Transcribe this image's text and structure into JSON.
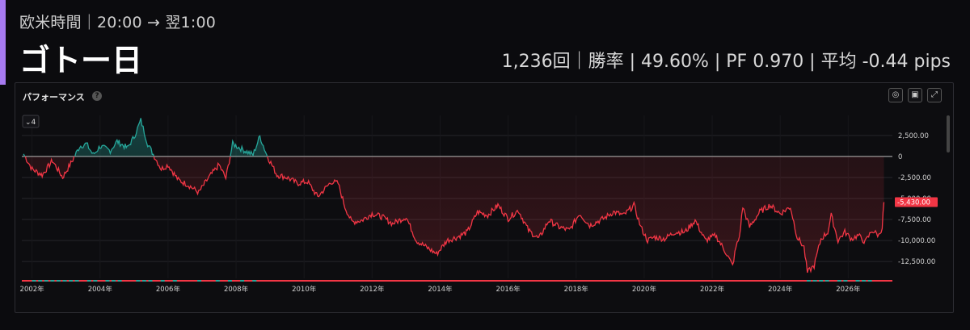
{
  "header": {
    "subtitle": "欧米時間｜20:00 → 翌1:00",
    "title": "ゴトー日",
    "stats": "1,236回｜勝率 | 49.60% | PF 0.970 | 平均 -0.44 pips"
  },
  "panel": {
    "title": "パフォーマンス",
    "help_icon": "question-icon",
    "dropdown_label": "4",
    "toolbar": [
      "settings-icon",
      "camera-icon",
      "expand-icon"
    ]
  },
  "chart_data": {
    "type": "area",
    "title": "パフォーマンス",
    "xlabel": "",
    "ylabel": "",
    "x_ticks": [
      "2002年",
      "2004年",
      "2006年",
      "2008年",
      "2010年",
      "2012年",
      "2014年",
      "2016年",
      "2018年",
      "2020年",
      "2022年",
      "2024年",
      "2026年"
    ],
    "y_ticks": [
      "2,500.00",
      "0",
      "-2,500.00",
      "-5,000.00",
      "-7,500.00",
      "-10,000.00",
      "-12,500.00"
    ],
    "ylim": [
      -14500,
      4500
    ],
    "xlim": [
      2001.7,
      2027.3
    ],
    "baseline": 0,
    "last_value_label": "-5,430.00",
    "colors": {
      "positive": "#26a69a",
      "negative": "#f23645",
      "baseline": "#bdbdbd",
      "grid": "#26262b",
      "label_bg": "#f23645"
    },
    "grid": true,
    "series": [
      {
        "x": [
          2001.75,
          2002.0,
          2002.3,
          2002.6,
          2002.9,
          2003.2,
          2003.4,
          2003.6,
          2003.8,
          2004.0,
          2004.3,
          2004.5,
          2004.8,
          2005.0,
          2005.2,
          2005.4,
          2005.6,
          2005.8,
          2006.0,
          2006.3,
          2006.6,
          2006.9,
          2007.2,
          2007.5,
          2007.7,
          2007.9,
          2008.2,
          2008.5,
          2008.7,
          2008.9,
          2009.2,
          2009.5,
          2009.8,
          2010.1,
          2010.4,
          2010.8,
          2011.0,
          2011.2,
          2011.4,
          2011.7,
          2012.0,
          2012.3,
          2012.6,
          2013.0,
          2013.3,
          2013.6,
          2013.9,
          2014.2,
          2014.5,
          2014.8,
          2015.1,
          2015.4,
          2015.7,
          2016.0,
          2016.3,
          2016.6,
          2016.9,
          2017.2,
          2017.5,
          2017.8,
          2018.1,
          2018.4,
          2018.8,
          2019.1,
          2019.4,
          2019.7,
          2019.9,
          2020.1,
          2020.3,
          2020.6,
          2020.9,
          2021.2,
          2021.5,
          2021.8,
          2022.1,
          2022.4,
          2022.6,
          2022.7,
          2022.8,
          2022.9,
          2023.1,
          2023.4,
          2023.7,
          2024.0,
          2024.3,
          2024.5,
          2024.7,
          2024.8,
          2024.9,
          2025.0,
          2025.2,
          2025.4,
          2025.5,
          2025.7,
          2025.9,
          2026.1,
          2026.3,
          2026.5,
          2026.7,
          2026.9,
          2027.0,
          2027.05
        ],
        "values": [
          300,
          -1500,
          -2200,
          -500,
          -2500,
          -400,
          1200,
          1500,
          200,
          1200,
          700,
          1800,
          1000,
          2300,
          4300,
          1500,
          0,
          -1500,
          -1000,
          -2800,
          -3400,
          -4300,
          -2500,
          -1000,
          -2600,
          1500,
          800,
          200,
          2400,
          200,
          -2200,
          -2500,
          -3200,
          -3000,
          -4800,
          -3000,
          -3200,
          -6000,
          -7800,
          -7600,
          -6800,
          -7200,
          -8000,
          -7200,
          -10000,
          -10800,
          -11600,
          -10000,
          -9600,
          -9000,
          -6600,
          -7000,
          -5800,
          -7400,
          -6400,
          -8800,
          -9800,
          -7600,
          -8400,
          -8800,
          -6800,
          -8200,
          -7400,
          -6600,
          -7000,
          -5800,
          -8400,
          -10000,
          -9600,
          -9800,
          -9000,
          -9000,
          -7600,
          -10000,
          -9400,
          -11400,
          -13000,
          -10800,
          -9600,
          -6000,
          -8400,
          -6600,
          -5800,
          -6800,
          -6000,
          -9600,
          -10800,
          -13800,
          -13400,
          -13000,
          -9800,
          -9000,
          -7000,
          -10000,
          -9000,
          -9800,
          -9400,
          -10200,
          -8800,
          -9400,
          -8400,
          -5430
        ]
      }
    ]
  }
}
